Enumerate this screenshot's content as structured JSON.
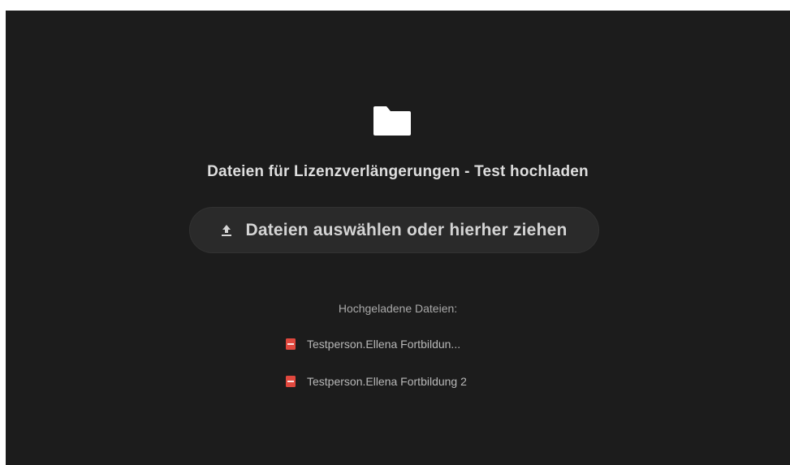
{
  "upload": {
    "title": "Dateien für Lizenzverlängerungen - Test hochladen",
    "button_label": "Dateien auswählen oder hierher ziehen",
    "folder_icon": "folder-icon",
    "upload_icon": "upload-icon"
  },
  "uploaded": {
    "heading": "Hochgeladene Dateien:",
    "files": [
      {
        "name": "Testperson.Ellena Fortbildun...",
        "icon": "pdf-file-icon"
      },
      {
        "name": "Testperson.Ellena Fortbildung 2",
        "icon": "pdf-file-icon"
      }
    ]
  },
  "colors": {
    "background": "#1c1c1c",
    "button_background": "#2a2a2a",
    "pdf_red": "#e0483e"
  }
}
